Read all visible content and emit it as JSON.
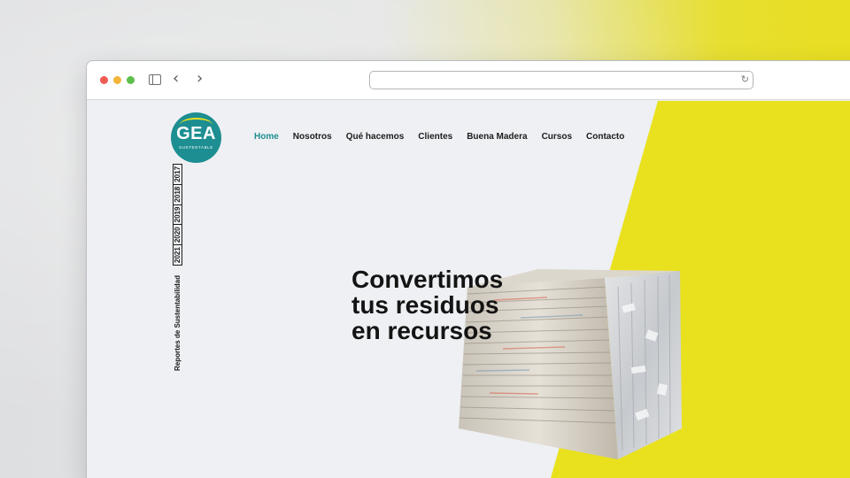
{
  "browser": {
    "address_value": ""
  },
  "site": {
    "logo": {
      "text": "GEA",
      "subtext": "SUSTENTABLE"
    },
    "nav": {
      "items": [
        {
          "label": "Home",
          "active": true
        },
        {
          "label": "Nosotros"
        },
        {
          "label": "Qué hacemos"
        },
        {
          "label": "Clientes"
        },
        {
          "label": "Buena Madera"
        },
        {
          "label": "Cursos"
        },
        {
          "label": "Contacto"
        }
      ]
    },
    "reports": {
      "label": "Reportes de Sustentabilidad",
      "years": [
        "2021",
        "2020",
        "2019",
        "2018",
        "2017"
      ]
    },
    "hero": {
      "lines": [
        "Convertimos",
        "tus residuos",
        "en recursos"
      ]
    },
    "colors": {
      "brand_teal": "#1d8e91",
      "accent_yellow": "#e9e11e"
    }
  }
}
